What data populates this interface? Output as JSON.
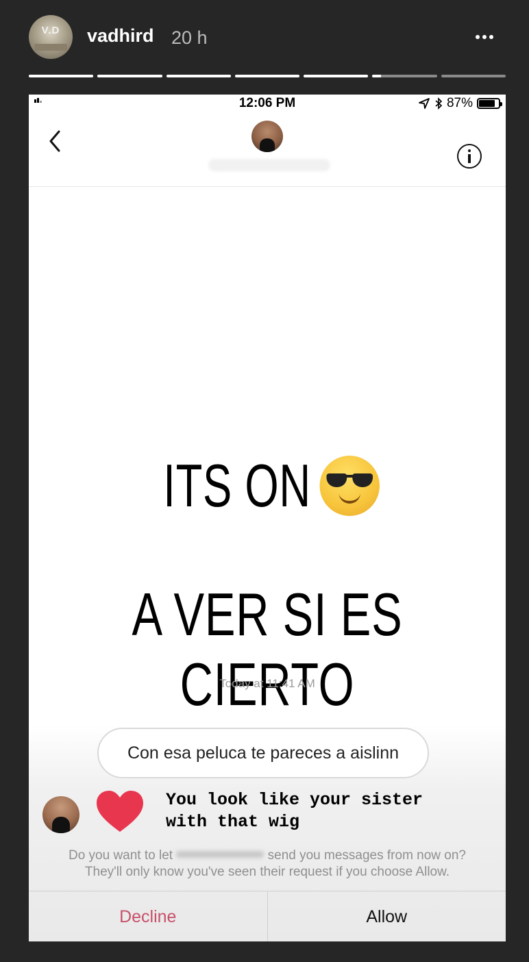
{
  "story": {
    "username": "vadhird",
    "time_ago": "20 h",
    "avatar_monogram": "V.D",
    "segments": [
      {
        "progress": 1.0
      },
      {
        "progress": 1.0
      },
      {
        "progress": 1.0
      },
      {
        "progress": 1.0
      },
      {
        "progress": 1.0
      },
      {
        "progress": 0.13
      },
      {
        "progress": 0.0
      }
    ]
  },
  "status_bar": {
    "time": "12:06 PM",
    "battery": "87%",
    "battery_level": 0.87
  },
  "message": {
    "overlay_line1": "ITS ON",
    "overlay_line2": "A VER SI ES CIERTO",
    "timestamp": "Today at 11:41 AM",
    "bubble_text": "Con esa peluca te pareces a aislinn",
    "translation": "You look like your sister\nwith that wig"
  },
  "request": {
    "prompt_before": "Do you want to let",
    "prompt_after": "send you messages from now on?",
    "prompt_line2": "They'll only know you've seen their request if you choose Allow.",
    "decline_label": "Decline",
    "allow_label": "Allow"
  },
  "colors": {
    "background": "#262626",
    "decline": "#c8506a",
    "heart": "#e8364f"
  }
}
